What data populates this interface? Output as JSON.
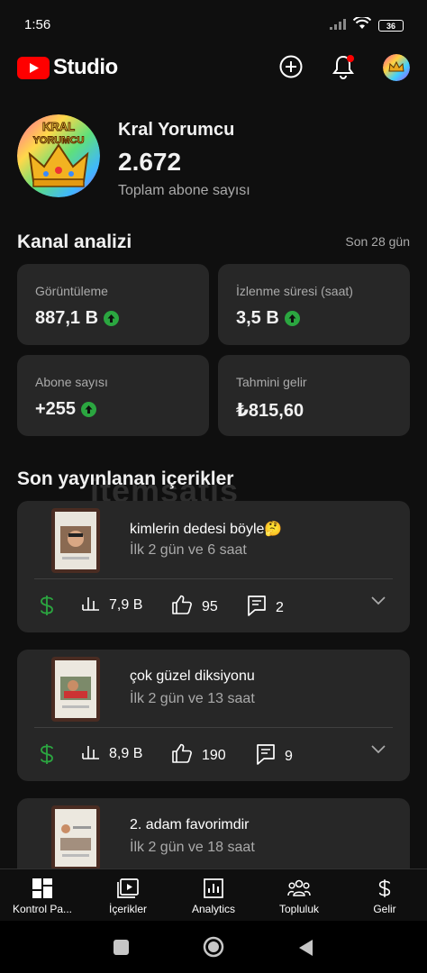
{
  "status_bar": {
    "time": "1:56",
    "battery": "36"
  },
  "header": {
    "logo_text": "Studio"
  },
  "channel": {
    "name": "Kral Yorumcu",
    "subscriber_count": "2.672",
    "subscriber_label": "Toplam abone sayısı",
    "avatar_text": [
      "KRAL",
      "YORUMCU"
    ]
  },
  "analytics": {
    "title": "Kanal analizi",
    "period": "Son 28 gün",
    "metrics": [
      {
        "label": "Görüntüleme",
        "value": "887,1 B",
        "trend": "up"
      },
      {
        "label": "İzlenme süresi (saat)",
        "value": "3,5 B",
        "trend": "up"
      },
      {
        "label": "Abone sayısı",
        "value": "+255",
        "trend": "up"
      },
      {
        "label": "Tahmini gelir",
        "value": "₺815,60",
        "trend": "none"
      }
    ]
  },
  "recent": {
    "title": "Son yayınlanan içerikler",
    "items": [
      {
        "title": "kimlerin dedesi böyle🤔",
        "subtitle": "İlk 2 gün ve 6 saat",
        "views": "7,9 B",
        "likes": "95",
        "comments": "2"
      },
      {
        "title": "çok güzel diksiyonu",
        "subtitle": "İlk 2 gün ve 13 saat",
        "views": "8,9 B",
        "likes": "190",
        "comments": "9"
      },
      {
        "title": "2. adam favorimdir",
        "subtitle": "İlk 2 gün ve 18 saat",
        "views": "",
        "likes": "",
        "comments": ""
      }
    ]
  },
  "bottom_nav": [
    {
      "label": "Kontrol Pa...",
      "icon": "dashboard-icon"
    },
    {
      "label": "İçerikler",
      "icon": "content-icon"
    },
    {
      "label": "Analytics",
      "icon": "analytics-icon"
    },
    {
      "label": "Topluluk",
      "icon": "community-icon"
    },
    {
      "label": "Gelir",
      "icon": "earn-icon"
    }
  ],
  "watermark": "itemsatış",
  "colors": {
    "background": "#0f0f0f",
    "card": "#272727",
    "accent_red": "#ff0000",
    "trend_green": "#2ba640",
    "money_green": "#2ba640"
  }
}
